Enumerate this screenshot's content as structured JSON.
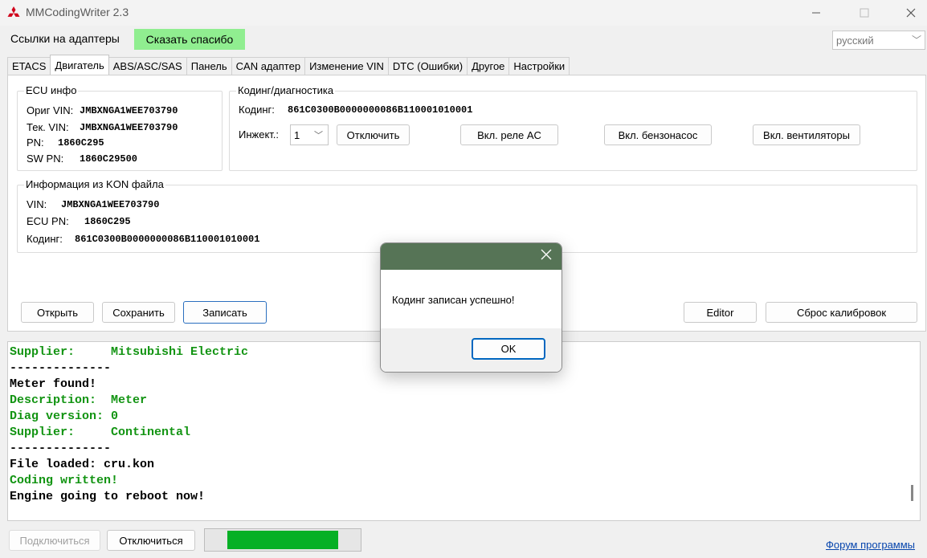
{
  "window": {
    "title": "MMCodingWriter 2.3"
  },
  "topbar": {
    "adapters_link": "Ссылки на адаптеры",
    "thanks_button": "Сказать спасибо",
    "language": "русский"
  },
  "tabs": [
    {
      "label": "ETACS"
    },
    {
      "label": "Двигатель"
    },
    {
      "label": "ABS/ASC/SAS"
    },
    {
      "label": "Панель"
    },
    {
      "label": "CAN адаптер"
    },
    {
      "label": "Изменение VIN"
    },
    {
      "label": "DTC (Ошибки)"
    },
    {
      "label": "Другое"
    },
    {
      "label": "Настройки"
    }
  ],
  "ecu_info": {
    "title": "ECU инфо",
    "orig_vin_label": "Ориг VIN:",
    "orig_vin": "JMBXNGA1WEE703790",
    "cur_vin_label": "Тек. VIN:",
    "cur_vin": "JMBXNGA1WEE703790",
    "pn_label": "PN:",
    "pn": "1860C295",
    "swpn_label": "SW PN:",
    "swpn": "1860C29500"
  },
  "coding": {
    "title": "Кодинг/диагностика",
    "coding_label": "Кодинг:",
    "coding_value": "861C0300B0000000086B110001010001",
    "injector_label": "Инжект.:",
    "injector_value": "1",
    "disable_button": "Отключить",
    "ac_relay_button": "Вкл. реле AC",
    "fuel_pump_button": "Вкл. бензонасос",
    "fans_button": "Вкл. вентиляторы"
  },
  "kon_info": {
    "title": "Информация из KON файла",
    "vin_label": "VIN:",
    "vin": "JMBXNGA1WEE703790",
    "ecupn_label": "ECU PN:",
    "ecupn": "1860C295",
    "coding_label": "Кодинг:",
    "coding_value": "861C0300B0000000086B110001010001"
  },
  "actions": {
    "open": "Открыть",
    "save": "Сохранить",
    "write": "Записать",
    "editor": "Editor",
    "reset_calib": "Сброс калибровок"
  },
  "console": {
    "colors": {
      "green": "#129412",
      "black": "#000000"
    },
    "lines": [
      {
        "text": "Supplier:     Mitsubishi Electric",
        "color": "green"
      },
      {
        "text": "--------------",
        "color": "black"
      },
      {
        "text": "Meter found!",
        "color": "black"
      },
      {
        "text": "Description:  Meter",
        "color": "green"
      },
      {
        "text": "Diag version: 0",
        "color": "green"
      },
      {
        "text": "Supplier:     Continental",
        "color": "green"
      },
      {
        "text": "--------------",
        "color": "black"
      },
      {
        "text": "File loaded: cru.kon",
        "color": "black"
      },
      {
        "text": "Coding written!",
        "color": "green"
      },
      {
        "text": "Engine going to reboot now!",
        "color": "black"
      }
    ]
  },
  "bottom": {
    "connect": "Подключиться",
    "disconnect": "Отключиться",
    "progress": 0.85,
    "forum_link": "Форум программы"
  },
  "dialog": {
    "message": "Кодинг записан успешно!",
    "ok": "OK"
  }
}
